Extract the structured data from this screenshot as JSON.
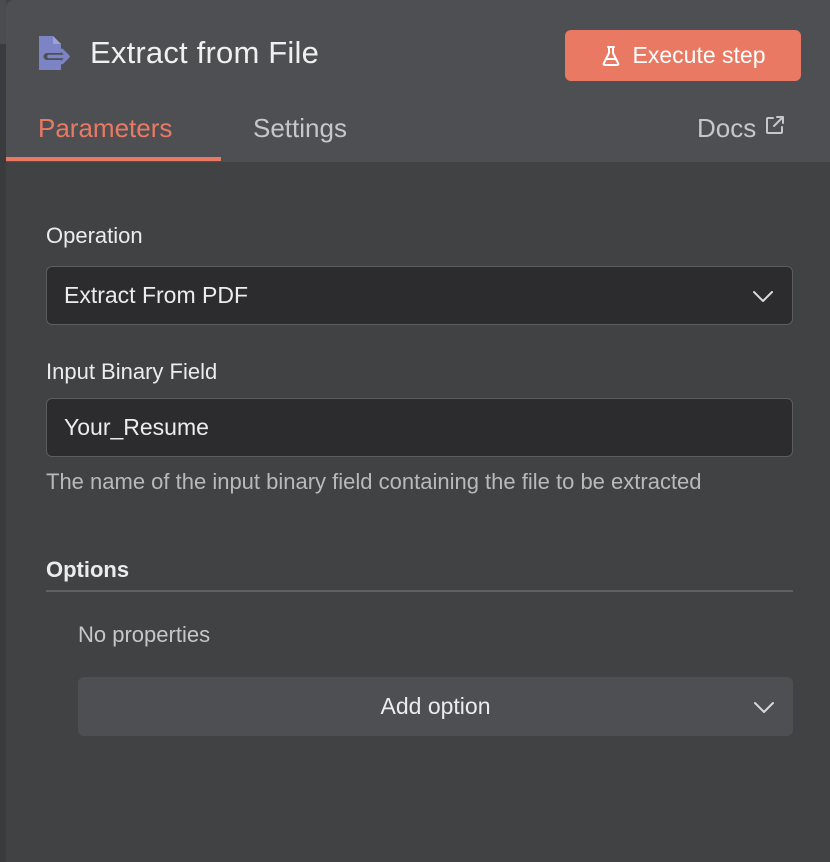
{
  "left_strip": {},
  "header": {
    "title": "Extract from File",
    "node_icon": "file-extract-icon",
    "execute_button": {
      "label": "Execute step",
      "icon": "flask-icon",
      "color": "#ea7963"
    }
  },
  "tabs": [
    {
      "label": "Parameters",
      "active": true
    },
    {
      "label": "Settings",
      "active": false
    }
  ],
  "docs": {
    "label": "Docs",
    "icon": "external-link-icon"
  },
  "form": {
    "operation": {
      "label": "Operation",
      "value": "Extract From PDF",
      "icon": "chevron-down-icon"
    },
    "input_binary_field": {
      "label": "Input Binary Field",
      "value": "Your_Resume",
      "hint": "The name of the input binary field containing the file to be extracted"
    },
    "options": {
      "label": "Options",
      "empty_text": "No properties",
      "add_option_label": "Add option",
      "icon": "chevron-down-icon"
    }
  },
  "colors": {
    "accent": "#ea7963",
    "panel_bg": "#414244",
    "header_bg": "#4e4f52",
    "input_bg": "#2c2c2e",
    "node_icon": "#7d84c6"
  }
}
